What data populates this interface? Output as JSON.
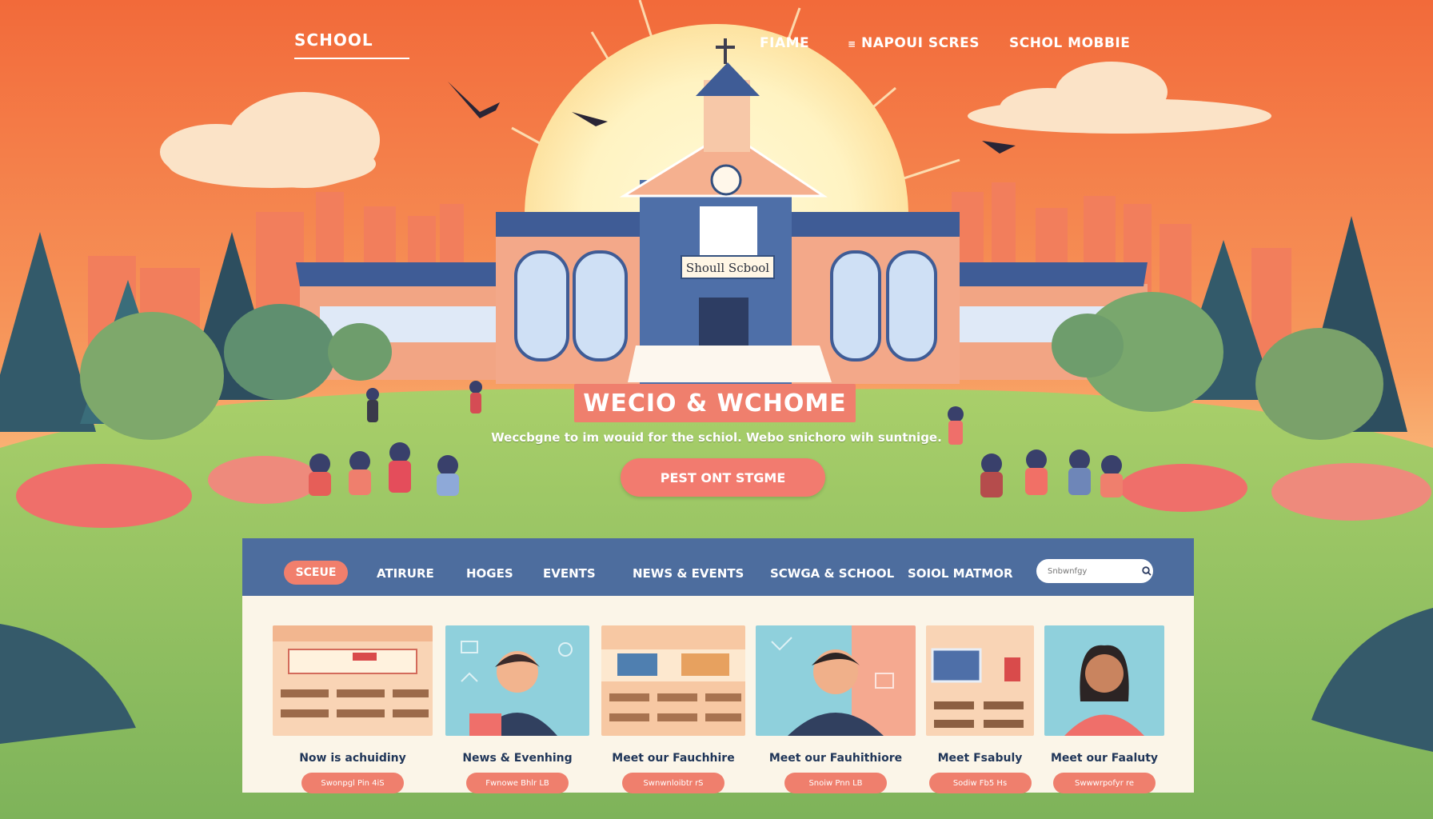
{
  "header": {
    "logo": "SCHOOL",
    "links": [
      "FIAME",
      "NAPOUI SCRES",
      "SCHOL MOBBIE"
    ]
  },
  "building": {
    "sign": "Shoull Scbool"
  },
  "hero": {
    "title": "WECIO & WCHOME",
    "subtitle": "Weccbgne to im wouid for the schiol. Webo snichoro wih suntnige.",
    "cta": "PEST ONT STGME"
  },
  "nav": {
    "active": "SCEUE",
    "items": [
      "ATIRURE",
      "HOGES",
      "EVENTS",
      "NEWS & EVENTS",
      "SCWGA & SCHOOL",
      "SOIOL MATMOR"
    ],
    "search_placeholder": "Snbwnfgy"
  },
  "cards": [
    {
      "title": "Now is achuidiny",
      "button": "Swonpgl Pin 4iS"
    },
    {
      "title": "News & Evenhing",
      "button": "Fwnowe Bhlr LB"
    },
    {
      "title": "Meet our Fauchhire",
      "button": "Swnwnloibtr rS"
    },
    {
      "title": "Meet our Fauhithiore",
      "button": "Snoiw Pnn LB"
    },
    {
      "title": "Meet Fsabuly",
      "button": "Sodiw Fb5 Hs"
    },
    {
      "title": "Meet our Faaluty",
      "button": "Swwwrpofyr re"
    }
  ],
  "colors": {
    "sky_orange": "#f47b3c",
    "accent_coral": "#ef7f6d",
    "nav_blue": "#4d6d9e",
    "cream": "#fbf5e8",
    "grass": "#8fc25e"
  }
}
